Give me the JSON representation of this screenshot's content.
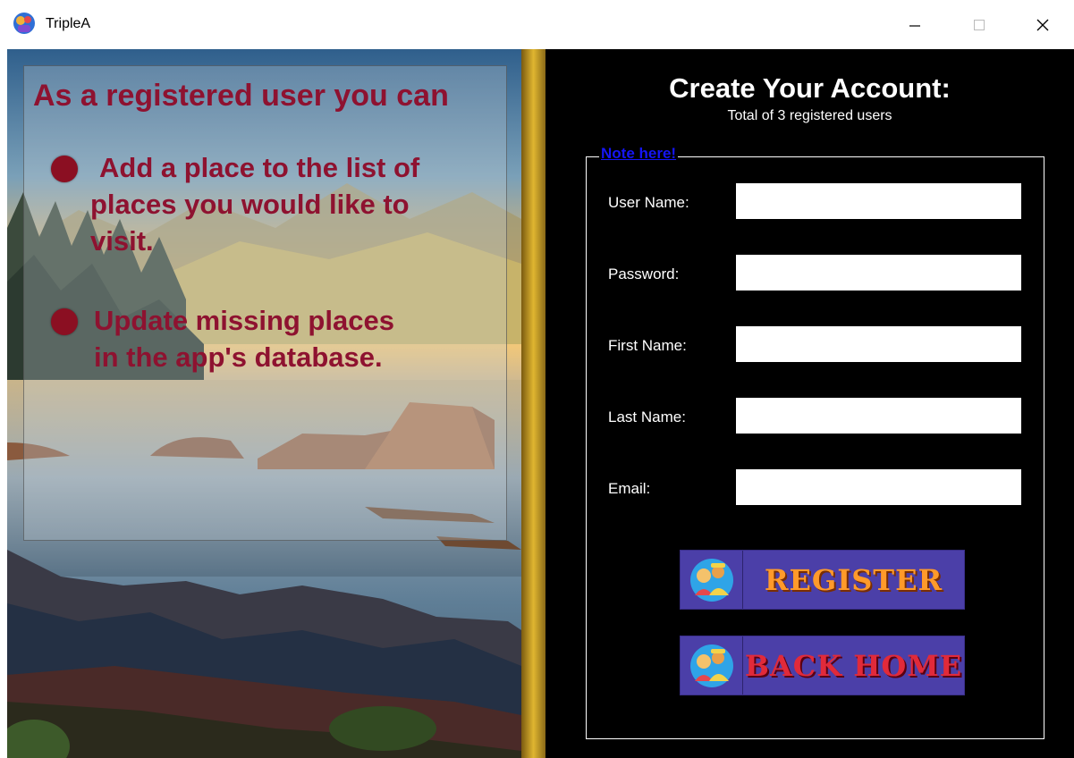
{
  "window": {
    "title": "TripleA"
  },
  "left": {
    "heading": "As a registered user you can",
    "bullets": [
      {
        "lines": [
          "Add a place to the list of",
          "places you would like to",
          "visit."
        ]
      },
      {
        "lines": [
          "Update missing places",
          "in the app's database."
        ]
      }
    ]
  },
  "form": {
    "title": "Create Your Account:",
    "subtitle": "Total of 3 registered users",
    "note_link": "Note here!",
    "fields": [
      {
        "label": "User Name:",
        "value": ""
      },
      {
        "label": "Password:",
        "value": ""
      },
      {
        "label": "First Name:",
        "value": ""
      },
      {
        "label": "Last Name:",
        "value": ""
      },
      {
        "label": "Email:",
        "value": ""
      }
    ],
    "register_label": "REGISTER",
    "back_label": "BACK HOME"
  },
  "icons": {
    "app": "triplea-logo-icon",
    "minimize": "minimize-icon",
    "maximize": "maximize-icon",
    "close": "close-icon",
    "buttons": "travelers-icon"
  }
}
